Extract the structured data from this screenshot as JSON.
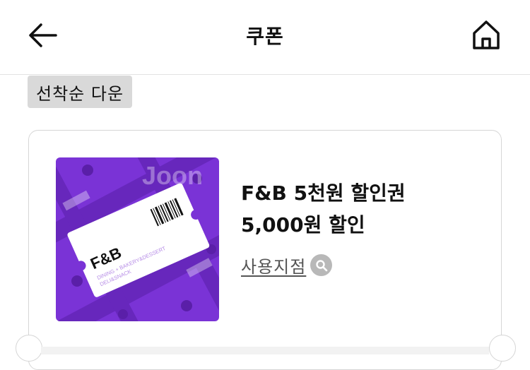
{
  "header": {
    "title": "쿠폰",
    "back_icon": "arrow-left-icon",
    "home_icon": "home-icon"
  },
  "badge": {
    "label": "선착순 다운"
  },
  "coupon": {
    "name": "F&B 5천원 할인권",
    "amount": "5,000원 할인",
    "stores_label": "사용지점",
    "stores_icon": "search-icon",
    "image": {
      "category": "F&B",
      "subtitle_line1": "DINING + BAKERY&DESSERT",
      "subtitle_line2": "DELI&SNACK",
      "watermark": "Joon",
      "background_color": "#7a33d6"
    }
  }
}
